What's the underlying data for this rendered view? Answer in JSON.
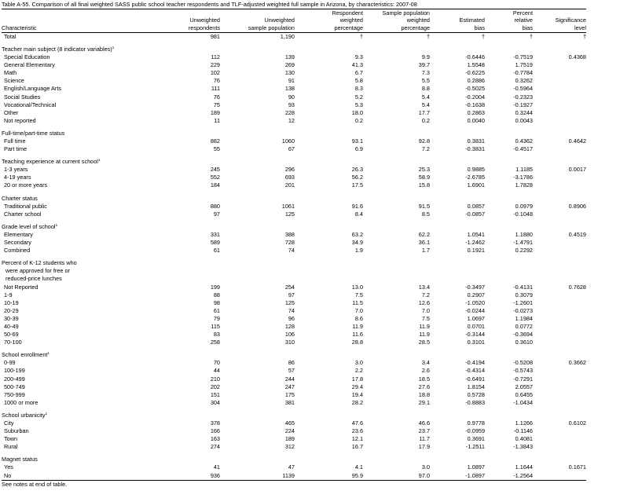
{
  "title": "Table A-55. Comparison of all final weighted SASS public school teacher respondents and TLF-adjusted weighted full sample in Arizona, by characteristics: 2007-08",
  "columns": {
    "characteristic": "Characteristic",
    "unweighted_respondents": [
      "Unweighted",
      "respondents"
    ],
    "unweighted_sample": [
      "Unweighted",
      "sample population"
    ],
    "respondent_pct": [
      "Respondent",
      "weighted",
      "percentage"
    ],
    "sample_pct": [
      "Sample population",
      "weighted",
      "percentage"
    ],
    "estimated_bias": [
      "Estimated",
      "bias"
    ],
    "percent_relative_bias": [
      "Percent",
      "relative",
      "bias"
    ],
    "significance": [
      "Significance",
      "level"
    ]
  },
  "rows": [
    {
      "kind": "total",
      "label": "Total",
      "c1": "981",
      "c2": "1,190",
      "c3": "†",
      "c4": "†",
      "c5": "†",
      "c6": "†",
      "c7": "†"
    },
    {
      "kind": "gap"
    },
    {
      "kind": "head",
      "label": "Teacher main subject (8 indicator variables)",
      "note": "1"
    },
    {
      "kind": "item",
      "label": "Special Education",
      "c1": "112",
      "c2": "139",
      "c3": "9.3",
      "c4": "9.9",
      "c5": "-0.6446",
      "c6": "-0.7519",
      "c7": "0.4368"
    },
    {
      "kind": "item",
      "label": "General Elementary",
      "c1": "229",
      "c2": "269",
      "c3": "41.3",
      "c4": "39.7",
      "c5": "1.5548",
      "c6": "1.7519",
      "c7": ""
    },
    {
      "kind": "item",
      "label": "Math",
      "c1": "102",
      "c2": "130",
      "c3": "6.7",
      "c4": "7.3",
      "c5": "-0.6225",
      "c6": "-0.7784",
      "c7": ""
    },
    {
      "kind": "item",
      "label": "Science",
      "c1": "76",
      "c2": "91",
      "c3": "5.8",
      "c4": "5.5",
      "c5": "0.2886",
      "c6": "0.3262",
      "c7": ""
    },
    {
      "kind": "item",
      "label": "English/Language Arts",
      "c1": "111",
      "c2": "138",
      "c3": "8.3",
      "c4": "8.8",
      "c5": "-0.5025",
      "c6": "-0.5964",
      "c7": ""
    },
    {
      "kind": "item",
      "label": "Social Studies",
      "c1": "76",
      "c2": "90",
      "c3": "5.2",
      "c4": "5.4",
      "c5": "-0.2004",
      "c6": "-0.2323",
      "c7": ""
    },
    {
      "kind": "item",
      "label": "Vocational/Technical",
      "c1": "75",
      "c2": "93",
      "c3": "5.3",
      "c4": "5.4",
      "c5": "-0.1638",
      "c6": "-0.1927",
      "c7": ""
    },
    {
      "kind": "item",
      "label": "Other",
      "c1": "189",
      "c2": "228",
      "c3": "18.0",
      "c4": "17.7",
      "c5": "0.2863",
      "c6": "0.3244",
      "c7": ""
    },
    {
      "kind": "item",
      "label": "Not reported",
      "c1": "11",
      "c2": "12",
      "c3": "0.2",
      "c4": "0.2",
      "c5": "0.0040",
      "c6": "0.0043",
      "c7": ""
    },
    {
      "kind": "gap"
    },
    {
      "kind": "head",
      "label": "Full-time/part-time status",
      "note": ""
    },
    {
      "kind": "item",
      "label": "Full time",
      "c1": "882",
      "c2": "1060",
      "c3": "93.1",
      "c4": "92.8",
      "c5": "0.3831",
      "c6": "0.4362",
      "c7": "0.4642"
    },
    {
      "kind": "item",
      "label": "Part time",
      "c1": "55",
      "c2": "67",
      "c3": "6.9",
      "c4": "7.2",
      "c5": "-0.3831",
      "c6": "-0.4517",
      "c7": ""
    },
    {
      "kind": "gap"
    },
    {
      "kind": "head",
      "label": "Teaching experience at current school",
      "note": "1"
    },
    {
      "kind": "item",
      "label": "1-3 years",
      "c1": "245",
      "c2": "296",
      "c3": "26.3",
      "c4": "25.3",
      "c5": "0.9885",
      "c6": "1.1185",
      "c7": "0.0017"
    },
    {
      "kind": "item",
      "label": "4-19 years",
      "c1": "552",
      "c2": "693",
      "c3": "56.2",
      "c4": "58.9",
      "c5": "-2.6785",
      "c6": "-3.1786",
      "c7": ""
    },
    {
      "kind": "item",
      "label": "20 or more years",
      "c1": "184",
      "c2": "201",
      "c3": "17.5",
      "c4": "15.8",
      "c5": "1.6901",
      "c6": "1.7828",
      "c7": ""
    },
    {
      "kind": "gap"
    },
    {
      "kind": "head",
      "label": "Charter status",
      "note": ""
    },
    {
      "kind": "item",
      "label": "Traditional public",
      "c1": "880",
      "c2": "1061",
      "c3": "91.6",
      "c4": "91.5",
      "c5": "0.0857",
      "c6": "0.0979",
      "c7": "0.8906"
    },
    {
      "kind": "item",
      "label": "Charter school",
      "c1": "97",
      "c2": "125",
      "c3": "8.4",
      "c4": "8.5",
      "c5": "-0.0857",
      "c6": "-0.1048",
      "c7": ""
    },
    {
      "kind": "gap"
    },
    {
      "kind": "head",
      "label": "Grade level of school",
      "note": "1"
    },
    {
      "kind": "item",
      "label": "Elementary",
      "c1": "331",
      "c2": "388",
      "c3": "63.2",
      "c4": "62.2",
      "c5": "1.0541",
      "c6": "1.1880",
      "c7": "0.4519"
    },
    {
      "kind": "item",
      "label": "Secondary",
      "c1": "589",
      "c2": "728",
      "c3": "34.9",
      "c4": "36.1",
      "c5": "-1.2462",
      "c6": "-1.4791",
      "c7": ""
    },
    {
      "kind": "item",
      "label": "Combined",
      "c1": "61",
      "c2": "74",
      "c3": "1.9",
      "c4": "1.7",
      "c5": "0.1921",
      "c6": "0.2292",
      "c7": ""
    },
    {
      "kind": "gap"
    },
    {
      "kind": "head",
      "label": "Percent of K-12 students who",
      "note": ""
    },
    {
      "kind": "head2",
      "label": "were approved for free or",
      "note": ""
    },
    {
      "kind": "head2",
      "label": "reduced-price lunches",
      "note": ""
    },
    {
      "kind": "item",
      "label": "Not Reported",
      "c1": "199",
      "c2": "254",
      "c3": "13.0",
      "c4": "13.4",
      "c5": "-0.3497",
      "c6": "-0.4131",
      "c7": "0.7628"
    },
    {
      "kind": "item",
      "label": "1-9",
      "c1": "88",
      "c2": "97",
      "c3": "7.5",
      "c4": "7.2",
      "c5": "0.2907",
      "c6": "0.3079",
      "c7": ""
    },
    {
      "kind": "item",
      "label": "10-19",
      "c1": "98",
      "c2": "125",
      "c3": "11.5",
      "c4": "12.6",
      "c5": "-1.0520",
      "c6": "-1.2601",
      "c7": ""
    },
    {
      "kind": "item",
      "label": "20-29",
      "c1": "61",
      "c2": "74",
      "c3": "7.0",
      "c4": "7.0",
      "c5": "-0.0244",
      "c6": "-0.0273",
      "c7": ""
    },
    {
      "kind": "item",
      "label": "30-39",
      "c1": "79",
      "c2": "96",
      "c3": "8.6",
      "c4": "7.5",
      "c5": "1.0697",
      "c6": "1.1984",
      "c7": ""
    },
    {
      "kind": "item",
      "label": "40-49",
      "c1": "115",
      "c2": "128",
      "c3": "11.9",
      "c4": "11.9",
      "c5": "0.0701",
      "c6": "0.0772",
      "c7": ""
    },
    {
      "kind": "item",
      "label": "50-69",
      "c1": "83",
      "c2": "106",
      "c3": "11.6",
      "c4": "11.9",
      "c5": "-0.3144",
      "c6": "-0.3694",
      "c7": ""
    },
    {
      "kind": "item",
      "label": "70-100",
      "c1": "258",
      "c2": "310",
      "c3": "28.8",
      "c4": "28.5",
      "c5": "0.3101",
      "c6": "0.3610",
      "c7": ""
    },
    {
      "kind": "gap"
    },
    {
      "kind": "head",
      "label": "School enrollment",
      "note": "1"
    },
    {
      "kind": "item",
      "label": "0-99",
      "c1": "70",
      "c2": "86",
      "c3": "3.0",
      "c4": "3.4",
      "c5": "-0.4194",
      "c6": "-0.5208",
      "c7": "0.3662"
    },
    {
      "kind": "item",
      "label": "100-199",
      "c1": "44",
      "c2": "57",
      "c3": "2.2",
      "c4": "2.6",
      "c5": "-0.4314",
      "c6": "-0.5743",
      "c7": ""
    },
    {
      "kind": "item",
      "label": "200-499",
      "c1": "210",
      "c2": "244",
      "c3": "17.8",
      "c4": "18.5",
      "c5": "-0.6491",
      "c6": "-0.7291",
      "c7": ""
    },
    {
      "kind": "item",
      "label": "500-749",
      "c1": "202",
      "c2": "247",
      "c3": "29.4",
      "c4": "27.6",
      "c5": "1.8154",
      "c6": "2.0557",
      "c7": ""
    },
    {
      "kind": "item",
      "label": "750-999",
      "c1": "151",
      "c2": "175",
      "c3": "19.4",
      "c4": "18.8",
      "c5": "0.5728",
      "c6": "0.6455",
      "c7": ""
    },
    {
      "kind": "item",
      "label": "1000 or more",
      "c1": "304",
      "c2": "381",
      "c3": "28.2",
      "c4": "29.1",
      "c5": "-0.8883",
      "c6": "-1.0434",
      "c7": ""
    },
    {
      "kind": "gap"
    },
    {
      "kind": "head",
      "label": "School urbanicity",
      "note": "1"
    },
    {
      "kind": "item",
      "label": "City",
      "c1": "378",
      "c2": "465",
      "c3": "47.6",
      "c4": "46.6",
      "c5": "0.9778",
      "c6": "1.1266",
      "c7": "0.6102"
    },
    {
      "kind": "item",
      "label": "Suburban",
      "c1": "166",
      "c2": "224",
      "c3": "23.6",
      "c4": "23.7",
      "c5": "-0.0959",
      "c6": "-0.1146",
      "c7": ""
    },
    {
      "kind": "item",
      "label": "Town",
      "c1": "163",
      "c2": "189",
      "c3": "12.1",
      "c4": "11.7",
      "c5": "0.3691",
      "c6": "0.4081",
      "c7": ""
    },
    {
      "kind": "item",
      "label": "Rural",
      "c1": "274",
      "c2": "312",
      "c3": "16.7",
      "c4": "17.9",
      "c5": "-1.2511",
      "c6": "-1.3843",
      "c7": ""
    },
    {
      "kind": "gap"
    },
    {
      "kind": "head",
      "label": "Magnet status",
      "note": ""
    },
    {
      "kind": "item",
      "label": "Yes",
      "c1": "41",
      "c2": "47",
      "c3": "4.1",
      "c4": "3.0",
      "c5": "1.0897",
      "c6": "1.1644",
      "c7": "0.1671"
    },
    {
      "kind": "item",
      "label": "No",
      "c1": "936",
      "c2": "1139",
      "c3": "95.9",
      "c4": "97.0",
      "c5": "-1.0897",
      "c6": "-1.2564",
      "c7": ""
    }
  ],
  "footnote": "See notes at end of table."
}
